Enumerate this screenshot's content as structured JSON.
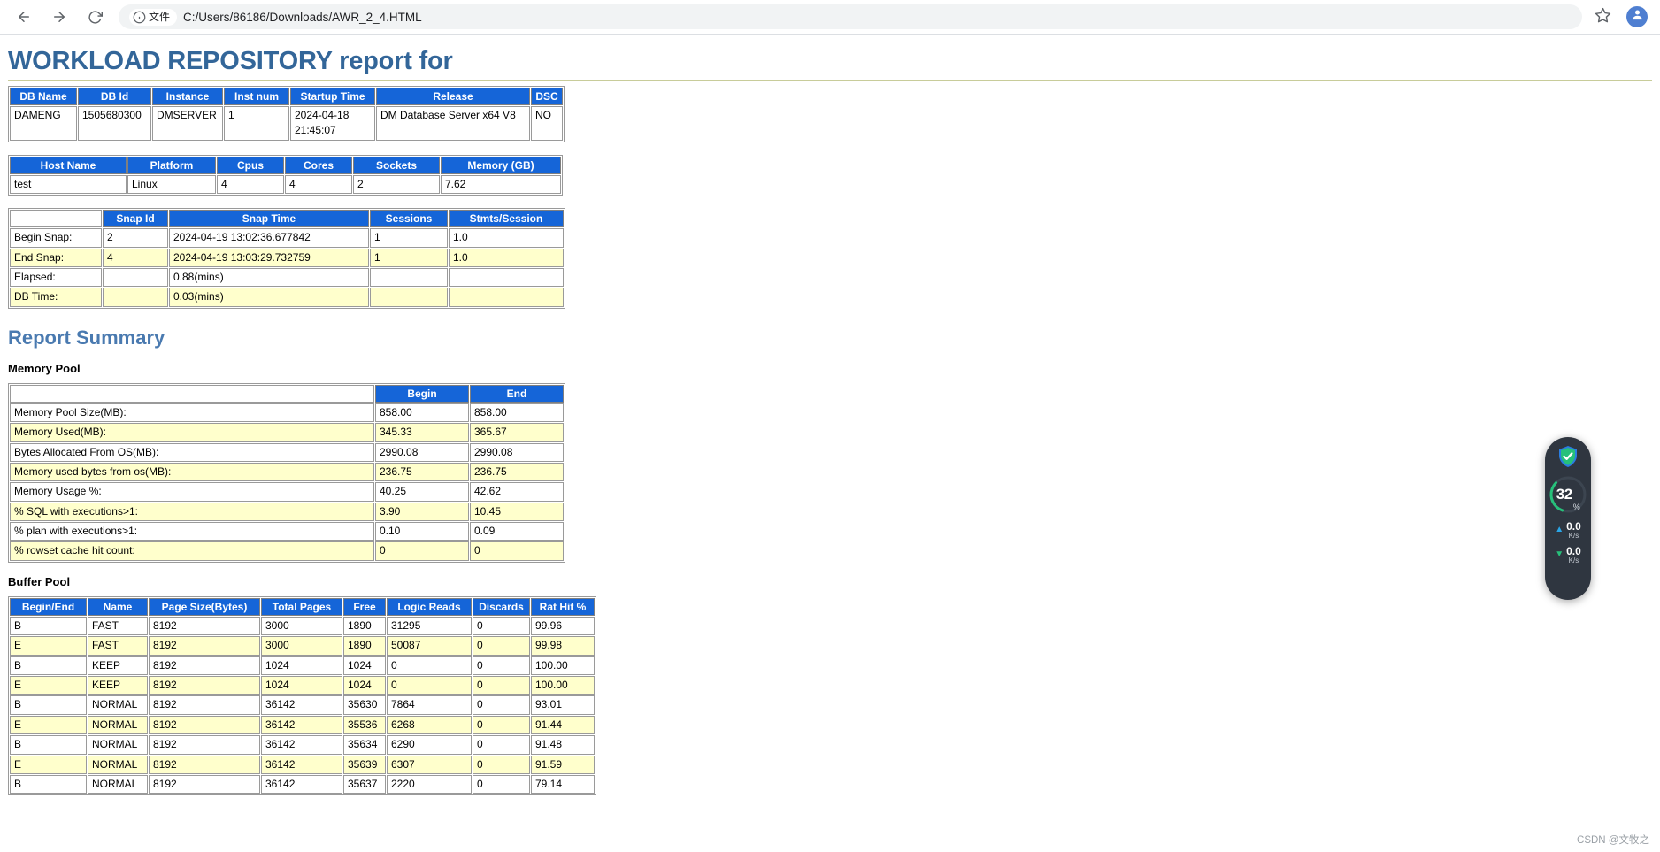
{
  "browser": {
    "back_icon": "back-arrow-icon",
    "forward_icon": "forward-arrow-icon",
    "reload_icon": "reload-icon",
    "file_label": "文件",
    "url": "C:/Users/86186/Downloads/AWR_2_4.HTML",
    "bookmark_icon": "star-icon",
    "profile_icon": "profile-avatar"
  },
  "report": {
    "title": "WORKLOAD REPOSITORY report for",
    "summary_heading": "Report Summary",
    "memory_pool_heading": "Memory Pool",
    "buffer_pool_heading": "Buffer Pool"
  },
  "db_table": {
    "headers": [
      "DB Name",
      "DB Id",
      "Instance",
      "Inst num",
      "Startup Time",
      "Release",
      "DSC"
    ],
    "rows": [
      [
        "DAMENG",
        "1505680300",
        "DMSERVER",
        "1",
        "2024-04-18\n21:45:07",
        "DM Database Server x64 V8",
        "NO"
      ]
    ]
  },
  "host_table": {
    "headers": [
      "Host Name",
      "Platform",
      "Cpus",
      "Cores",
      "Sockets",
      "Memory (GB)"
    ],
    "rows": [
      [
        "test",
        "Linux",
        "4",
        "4",
        "2",
        "7.62"
      ]
    ]
  },
  "snap_table": {
    "headers": [
      "",
      "Snap Id",
      "Snap Time",
      "Sessions",
      "Stmts/Session"
    ],
    "rows": [
      [
        "Begin Snap:",
        "2",
        "2024-04-19 13:02:36.677842",
        "1",
        "1.0"
      ],
      [
        "End Snap:",
        "4",
        "2024-04-19 13:03:29.732759",
        "1",
        "1.0"
      ],
      [
        "Elapsed:",
        "",
        "0.88(mins)",
        "",
        ""
      ],
      [
        "DB Time:",
        "",
        "0.03(mins)",
        "",
        ""
      ]
    ]
  },
  "memory_pool_table": {
    "headers": [
      "",
      "Begin",
      "End"
    ],
    "rows": [
      [
        "Memory Pool Size(MB):",
        "858.00",
        "858.00"
      ],
      [
        "Memory Used(MB):",
        "345.33",
        "365.67"
      ],
      [
        "Bytes Allocated From OS(MB):",
        "2990.08",
        "2990.08"
      ],
      [
        "Memory used bytes from os(MB):",
        "236.75",
        "236.75"
      ],
      [
        "Memory Usage %:",
        "40.25",
        "42.62"
      ],
      [
        "% SQL with executions>1:",
        "3.90",
        "10.45"
      ],
      [
        "% plan with executions>1:",
        "0.10",
        "0.09"
      ],
      [
        "% rowset cache hit count:",
        "0",
        "0"
      ]
    ]
  },
  "buffer_pool_table": {
    "headers": [
      "Begin/End",
      "Name",
      "Page Size(Bytes)",
      "Total Pages",
      "Free",
      "Logic Reads",
      "Discards",
      "Rat Hit %"
    ],
    "rows": [
      [
        "B",
        "FAST",
        "8192",
        "3000",
        "1890",
        "31295",
        "0",
        "99.96"
      ],
      [
        "E",
        "FAST",
        "8192",
        "3000",
        "1890",
        "50087",
        "0",
        "99.98"
      ],
      [
        "B",
        "KEEP",
        "8192",
        "1024",
        "1024",
        "0",
        "0",
        "100.00"
      ],
      [
        "E",
        "KEEP",
        "8192",
        "1024",
        "1024",
        "0",
        "0",
        "100.00"
      ],
      [
        "B",
        "NORMAL",
        "8192",
        "36142",
        "35630",
        "7864",
        "0",
        "93.01"
      ],
      [
        "E",
        "NORMAL",
        "8192",
        "36142",
        "35536",
        "6268",
        "0",
        "91.44"
      ],
      [
        "B",
        "NORMAL",
        "8192",
        "36142",
        "35634",
        "6290",
        "0",
        "91.48"
      ],
      [
        "E",
        "NORMAL",
        "8192",
        "36142",
        "35639",
        "6307",
        "0",
        "91.59"
      ],
      [
        "B",
        "NORMAL",
        "8192",
        "36142",
        "35637",
        "2220",
        "0",
        "79.14"
      ]
    ]
  },
  "perf_widget": {
    "shield_icon": "shield-check-icon",
    "cpu_value": "32",
    "cpu_unit": "%",
    "upload_value": "0.0",
    "upload_unit": "K/s",
    "download_value": "0.0",
    "download_unit": "K/s",
    "ring_color": "#27c07a",
    "panel_color": "#2f3640"
  },
  "watermark": "CSDN @文牧之"
}
